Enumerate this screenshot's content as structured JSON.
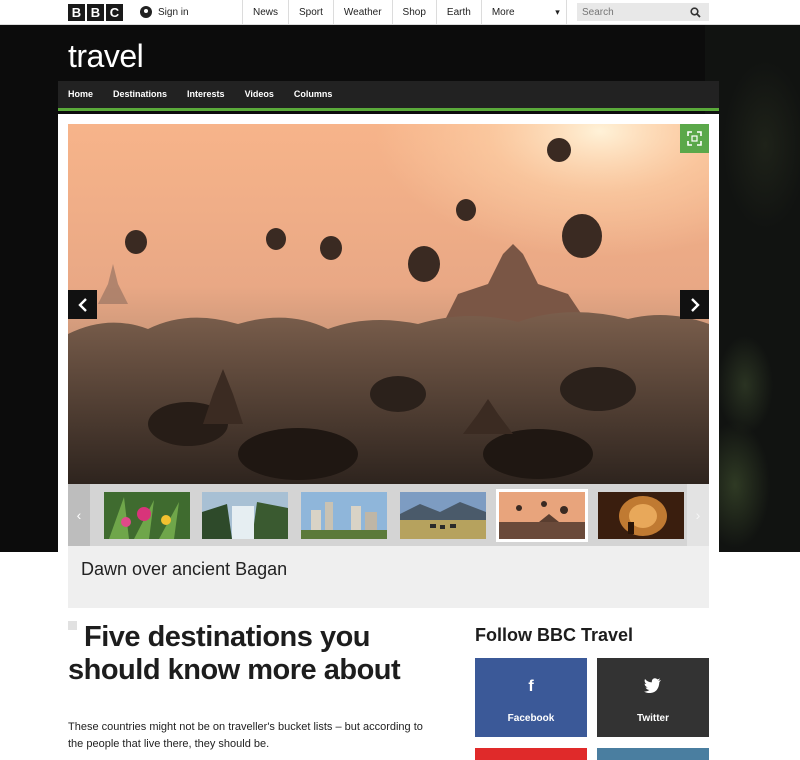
{
  "topbar": {
    "logo_letters": [
      "B",
      "B",
      "C"
    ],
    "signin_label": "Sign in",
    "nav": [
      {
        "label": "News"
      },
      {
        "label": "Sport"
      },
      {
        "label": "Weather"
      },
      {
        "label": "Shop"
      },
      {
        "label": "Earth"
      }
    ],
    "more_label": "More",
    "search_placeholder": "Search"
  },
  "section": {
    "title": "travel",
    "nav": [
      {
        "label": "Home"
      },
      {
        "label": "Destinations"
      },
      {
        "label": "Interests"
      },
      {
        "label": "Videos"
      },
      {
        "label": "Columns"
      }
    ]
  },
  "gallery": {
    "caption": "Dawn over ancient Bagan",
    "thumbnails": [
      {
        "subject": "flowers"
      },
      {
        "subject": "waterfall"
      },
      {
        "subject": "city"
      },
      {
        "subject": "savanna"
      },
      {
        "subject": "balloons"
      },
      {
        "subject": "cave"
      }
    ],
    "active_thumbnail": 4
  },
  "article": {
    "headline": "Five destinations you should know more about",
    "summary": "These countries might not be on traveller's bucket lists – but according to the people that live there, they should be."
  },
  "follow": {
    "title": "Follow BBC Travel",
    "buttons": [
      {
        "glyph": "f",
        "label": "Facebook"
      },
      {
        "glyph": "🐦",
        "label": "Twitter"
      }
    ]
  },
  "colors": {
    "accent_green": "#5aa84a",
    "facebook_blue": "#3b5998",
    "twitter_dark": "#333333",
    "hero_dark": "#0c0c0c"
  }
}
